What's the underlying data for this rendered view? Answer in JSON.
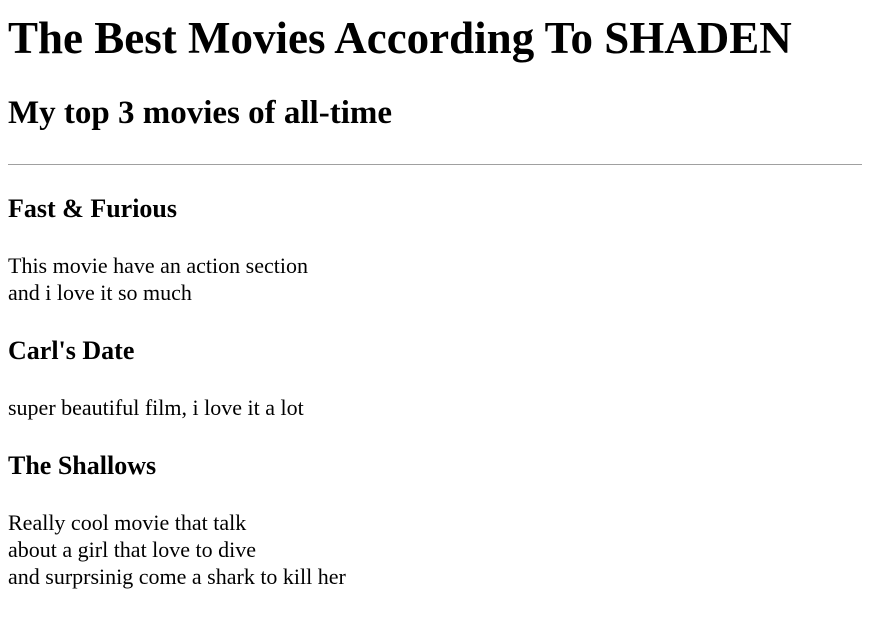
{
  "page": {
    "title": "The Best Movies According To SHADEN",
    "subtitle": "My top 3 movies of all-time"
  },
  "movies": [
    {
      "name": "Fast & Furious",
      "lines": [
        "This movie have an action section",
        "and i love it so much"
      ]
    },
    {
      "name": "Carl's Date",
      "lines": [
        "super beautiful film, i love it a lot"
      ]
    },
    {
      "name": "The Shallows",
      "lines": [
        "Really cool movie that talk",
        "about a girl that love to dive",
        "and surprsinig come a shark to kill her"
      ]
    }
  ]
}
